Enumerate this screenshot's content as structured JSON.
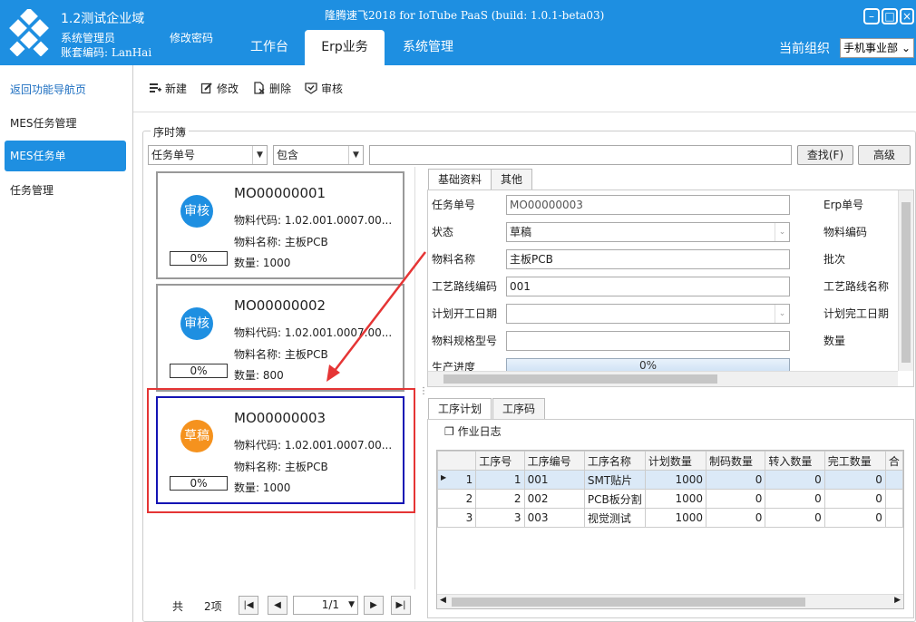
{
  "header": {
    "org_name": "1.2测试企业域",
    "user_role": "系统管理员",
    "account": "账套编码: LanHai",
    "change_password": "修改密码",
    "window_title": "隆腾速飞2018 for IoTube PaaS (build: 1.0.1-beta03)",
    "tabs": [
      "工作台",
      "Erp业务",
      "系统管理"
    ],
    "active_tab": "Erp业务",
    "current_org_label": "当前组织",
    "current_org_value": "手机事业部",
    "brand_color": "#1e8fe1"
  },
  "sidebar": {
    "items": [
      {
        "label": "返回功能导航页"
      },
      {
        "label": "MES任务管理"
      },
      {
        "label": "MES任务单"
      },
      {
        "label": "任务管理"
      }
    ],
    "selected": "MES任务单"
  },
  "toolbar": {
    "new_label": "新建",
    "edit_label": "修改",
    "delete_label": "删除",
    "audit_label": "审核"
  },
  "filter": {
    "group_label": "序时簿",
    "field": "任务单号",
    "operator": "包含",
    "value": "",
    "search_label": "查找(F)",
    "advanced_label": "高级"
  },
  "cards": [
    {
      "status": "审核",
      "status_color": "#1e8fe1",
      "no": "MO00000001",
      "code": "物料代码: 1.02.001.0007.00...",
      "name": "物料名称: 主板PCB",
      "progress": "0%",
      "qty": "数量: 1000"
    },
    {
      "status": "审核",
      "status_color": "#1e8fe1",
      "no": "MO00000002",
      "code": "物料代码: 1.02.001.0007.00...",
      "name": "物料名称: 主板PCB",
      "progress": "0%",
      "qty": "数量: 800"
    },
    {
      "status": "草稿",
      "status_color": "#f5921e",
      "no": "MO00000003",
      "code": "物料代码: 1.02.001.0007.00...",
      "name": "物料名称: 主板PCB",
      "progress": "0%",
      "qty": "数量: 1000"
    }
  ],
  "pager": {
    "total_prefix": "共",
    "total_count": "2项",
    "page": "1/1"
  },
  "detail": {
    "tabs": [
      "基础资料",
      "其他"
    ],
    "fields": {
      "task_no_label": "任务单号",
      "task_no": "MO00000003",
      "status_label": "状态",
      "status": "草稿",
      "material_name_label": "物料名称",
      "material_name": "主板PCB",
      "route_code_label": "工艺路线编码",
      "route_code": "001",
      "plan_start_label": "计划开工日期",
      "plan_start": "",
      "spec_label": "物料规格型号",
      "spec": "",
      "progress_label": "生产进度",
      "progress": "0%",
      "erp_no_label": "Erp单号",
      "material_code_label": "物料编码",
      "batch_label": "批次",
      "route_name_label": "工艺路线名称",
      "plan_end_label": "计划完工日期",
      "qty_label": "数量"
    }
  },
  "process": {
    "tabs": [
      "工序计划",
      "工序码"
    ],
    "log_label": "作业日志",
    "columns": [
      "工序号",
      "工序编号",
      "工序名称",
      "计划数量",
      "制码数量",
      "转入数量",
      "完工数量",
      "合"
    ],
    "rows": [
      {
        "idx": "1",
        "seq": "1",
        "code": "001",
        "name": "SMT贴片",
        "plan": "1000",
        "made": "0",
        "in": "0",
        "done": "0"
      },
      {
        "idx": "2",
        "seq": "2",
        "code": "002",
        "name": "PCB板分割",
        "plan": "1000",
        "made": "0",
        "in": "0",
        "done": "0"
      },
      {
        "idx": "3",
        "seq": "3",
        "code": "003",
        "name": "视觉测试",
        "plan": "1000",
        "made": "0",
        "in": "0",
        "done": "0"
      }
    ]
  }
}
